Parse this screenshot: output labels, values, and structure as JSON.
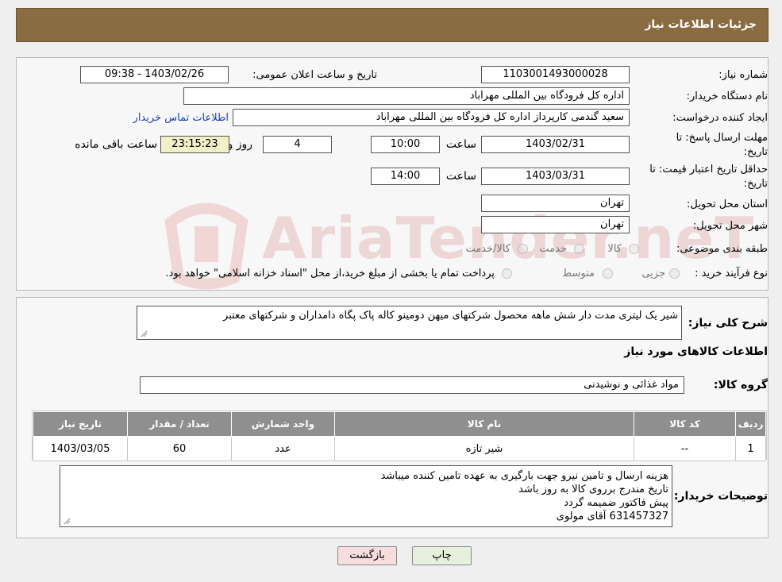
{
  "page_title": "جزئیات اطلاعات نیاز",
  "fields": {
    "need_number": {
      "label": "شماره نیاز:",
      "value": "1103001493000028"
    },
    "announce_datetime": {
      "label": "تاریخ و ساعت اعلان عمومی:",
      "value": "1403/02/26 - 09:38"
    },
    "buyer_org": {
      "label": "نام دستگاه خریدار:",
      "value": "اداره کل فرودگاه بین المللی مهراباد"
    },
    "requester": {
      "label": "ایجاد کننده درخواست:",
      "value": "سعید گندمی کارپرداز اداره کل فرودگاه بین المللی مهراباد",
      "contact_link": "اطلاعات تماس خریدار"
    },
    "reply_deadline": {
      "label_line1": "مهلت ارسال پاسخ: تا",
      "label_line2": "تاریخ:",
      "date": "1403/02/31",
      "time_label": "ساعت",
      "time": "10:00",
      "days": "4",
      "days_label": "روز و",
      "remaining": "23:15:23",
      "remaining_label": "ساعت باقی مانده"
    },
    "price_validity": {
      "label_line1": "حداقل تاریخ اعتبار قیمت: تا",
      "label_line2": "تاریخ:",
      "date": "1403/03/31",
      "time_label": "ساعت",
      "time": "14:00"
    },
    "delivery_province": {
      "label": "استان محل تحویل:",
      "value": "تهران"
    },
    "delivery_city": {
      "label": "شهر محل تحویل:",
      "value": "تهران"
    },
    "category": {
      "label": "طبقه بندی موضوعی:",
      "options": [
        "کالا",
        "خدمت",
        "کالا/خدمت"
      ]
    },
    "purchase_type": {
      "label": "نوع فرآیند خرید :",
      "options": [
        "جزیی",
        "متوسط"
      ],
      "note": "پرداخت تمام یا بخشی از مبلغ خرید،از محل \"اسناد خزانه اسلامی\" خواهد بود."
    }
  },
  "summary": {
    "label": "شرح کلی نیاز:",
    "value": "شیر یک لیتری مدت دار شش ماهه محصول شرکتهای میهن دومینو کاله پاک پگاه دامداران و شرکتهای معتبر"
  },
  "goods_section_title": "اطلاعات کالاهای مورد نیاز",
  "goods_group": {
    "label": "گروه کالا:",
    "value": "مواد غذائی و نوشیدنی"
  },
  "table": {
    "headers": [
      "ردیف",
      "کد کالا",
      "نام کالا",
      "واحد شمارش",
      "تعداد / مقدار",
      "تاریخ نیاز"
    ],
    "rows": [
      [
        "1",
        "--",
        "شیر تازه",
        "عدد",
        "60",
        "1403/03/05"
      ]
    ]
  },
  "buyer_notes": {
    "label": "توضیحات خریدار:",
    "lines": [
      "هزینه ارسال و تامین نیرو جهت بارگیری به عهده تامین کننده میباشد",
      "تاریخ مندرج برروی کالا به روز باشد",
      "پیش فاکتور ضمیمه گردد",
      "631457327 آقای مولوی"
    ]
  },
  "buttons": {
    "print": "چاپ",
    "back": "بازگشت"
  },
  "watermark": "AriaTender.neT",
  "colors": {
    "header": "#8a6c42",
    "link": "#1a3ebd",
    "table_header": "#8f8f8f",
    "back_button": "#f6dede",
    "print_button": "#e5f1de"
  }
}
